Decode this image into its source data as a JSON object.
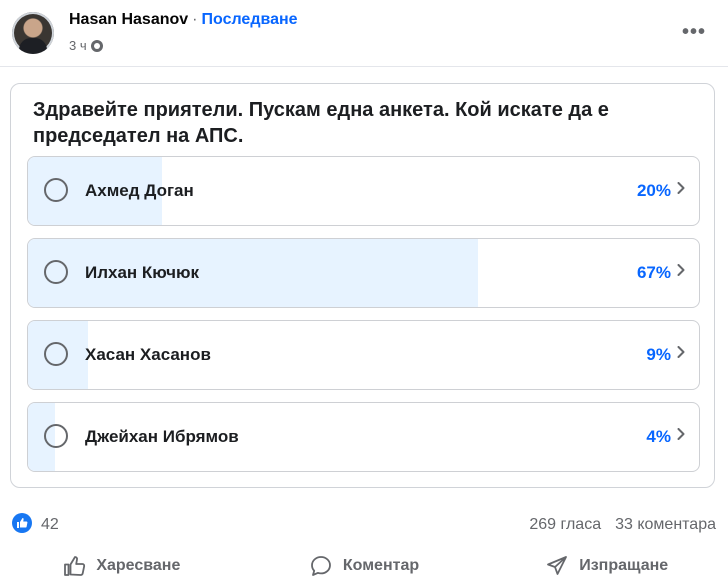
{
  "post": {
    "author": "Hasan Hasanov",
    "separator": "·",
    "follow_label": "Последване",
    "time": "3 ч",
    "more_label": "•••"
  },
  "poll": {
    "question": "Здравейте приятели. Пускам една анкета. Кой искате да е председател на АПС.",
    "options": [
      {
        "label": "Ахмед Доган",
        "percent_text": "20%",
        "percent": 20
      },
      {
        "label": "Илхан Кючюк",
        "percent_text": "67%",
        "percent": 67
      },
      {
        "label": "Хасан Хасанов",
        "percent_text": "9%",
        "percent": 9
      },
      {
        "label": "Джейхан Ибрямов",
        "percent_text": "4%",
        "percent": 4
      }
    ]
  },
  "stats": {
    "likes": "42",
    "votes": "269 гласа",
    "comments": "33 коментара"
  },
  "actions": {
    "like": "Харесване",
    "comment": "Коментар",
    "share": "Изпращане"
  },
  "colors": {
    "accent": "#0866ff",
    "bar_fill": "#e7f3ff",
    "muted_text": "#65676b"
  }
}
